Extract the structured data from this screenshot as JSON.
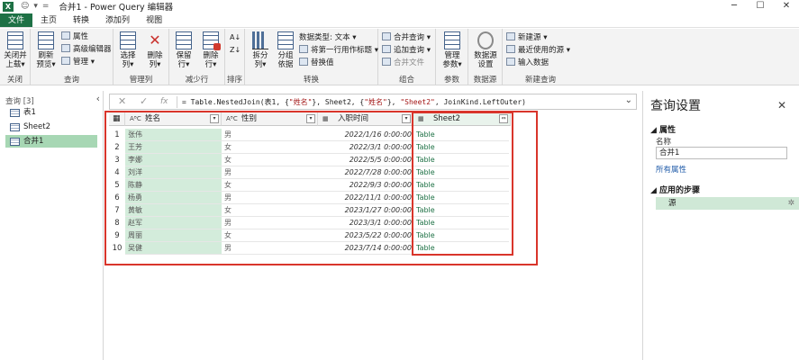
{
  "title_bar": {
    "app_icon": "X",
    "qa_icons": [
      "☺",
      "▾",
      "="
    ],
    "title": "合并1 - Power Query 编辑器",
    "min": "─",
    "max": "☐",
    "close": "✕"
  },
  "menu": {
    "tabs": [
      "文件",
      "主页",
      "转换",
      "添加列",
      "视图"
    ]
  },
  "ribbon": {
    "close_apply": [
      "关闭并",
      "上载▾"
    ],
    "group_close": "关闭",
    "refresh": [
      "刷新",
      "预览▾"
    ],
    "properties": "属性",
    "advanced_editor": "高级编辑器",
    "manage": "管理 ▾",
    "group_query": "查询",
    "choose_cols": [
      "选择",
      "列▾"
    ],
    "remove_cols": [
      "删除",
      "列▾"
    ],
    "group_manage_cols": "管理列",
    "keep_rows": [
      "保留",
      "行▾"
    ],
    "remove_rows": [
      "删除",
      "行▾"
    ],
    "group_reduce_rows": "减少行",
    "group_sort": "排序",
    "split_col": [
      "拆分",
      "列▾"
    ],
    "group_by": [
      "分组",
      "依据"
    ],
    "data_type": "数据类型: 文本 ▾",
    "first_row_header": "将第一行用作标题 ▾",
    "replace_values": "替换值",
    "group_transform": "转换",
    "merge_queries": "合并查询 ▾",
    "append_queries": "追加查询 ▾",
    "combine_files": "合并文件",
    "group_combine": "组合",
    "manage_params": [
      "管理",
      "参数▾"
    ],
    "group_params": "参数",
    "data_source_settings": [
      "数据源",
      "设置"
    ],
    "group_data_sources": "数据源",
    "new_source": "新建源 ▾",
    "recent_sources": "最近使用的源 ▾",
    "enter_data": "输入数据",
    "group_new_query": "新建查询"
  },
  "query_pane": {
    "header": "查询 [3]",
    "collapse": "‹",
    "items": [
      "表1",
      "Sheet2",
      "合并1"
    ]
  },
  "formula_bar": {
    "cancel": "✕",
    "commit": "✓",
    "fx": "fx",
    "part1": "= Table.NestedJoin(表1, {",
    "str1": "\"姓名\"",
    "part2": "}, Sheet2, {",
    "str2": "\"姓名\"",
    "part3": "}, ",
    "str3": "\"Sheet2\"",
    "part4": ", JoinKind.LeftOuter)",
    "expand": "⌄"
  },
  "grid": {
    "columns": [
      {
        "type": "AᴮC",
        "name": "姓名"
      },
      {
        "type": "AᴮC",
        "name": "性别"
      },
      {
        "type": "▦",
        "name": "入职时间"
      },
      {
        "type": "▦",
        "name": "Sheet2"
      }
    ],
    "dropdown_glyph": "▾",
    "expand_glyph": "⇔",
    "rows": [
      {
        "n": "1",
        "name": "张伟",
        "sex": "男",
        "date": "2022/1/16 0:00:00",
        "t": "Table"
      },
      {
        "n": "2",
        "name": "王芳",
        "sex": "女",
        "date": "2022/3/1 0:00:00",
        "t": "Table"
      },
      {
        "n": "3",
        "name": "李娜",
        "sex": "女",
        "date": "2022/5/5 0:00:00",
        "t": "Table"
      },
      {
        "n": "4",
        "name": "刘洋",
        "sex": "男",
        "date": "2022/7/28 0:00:00",
        "t": "Table"
      },
      {
        "n": "5",
        "name": "陈静",
        "sex": "女",
        "date": "2022/9/3 0:00:00",
        "t": "Table"
      },
      {
        "n": "6",
        "name": "杨勇",
        "sex": "男",
        "date": "2022/11/1 0:00:00",
        "t": "Table"
      },
      {
        "n": "7",
        "name": "黄敏",
        "sex": "女",
        "date": "2023/1/27 0:00:00",
        "t": "Table"
      },
      {
        "n": "8",
        "name": "赵军",
        "sex": "男",
        "date": "2023/3/1 0:00:00",
        "t": "Table"
      },
      {
        "n": "9",
        "name": "周丽",
        "sex": "女",
        "date": "2023/5/22 0:00:00",
        "t": "Table"
      },
      {
        "n": "10",
        "name": "吴健",
        "sex": "男",
        "date": "2023/7/14 0:00:00",
        "t": "Table"
      }
    ]
  },
  "settings_pane": {
    "title": "查询设置",
    "close": "✕",
    "properties_section": "◢ 属性",
    "name_label": "名称",
    "name_value": "合并1",
    "all_properties": "所有属性",
    "steps_section": "◢ 应用的步骤",
    "steps": [
      "源"
    ],
    "step_gear": "✲"
  },
  "colors": {
    "excel_green": "#1e7145",
    "highlight_green": "#a7d7b4",
    "annotation_red": "#d9352b",
    "link_blue": "#1e5aa8"
  }
}
